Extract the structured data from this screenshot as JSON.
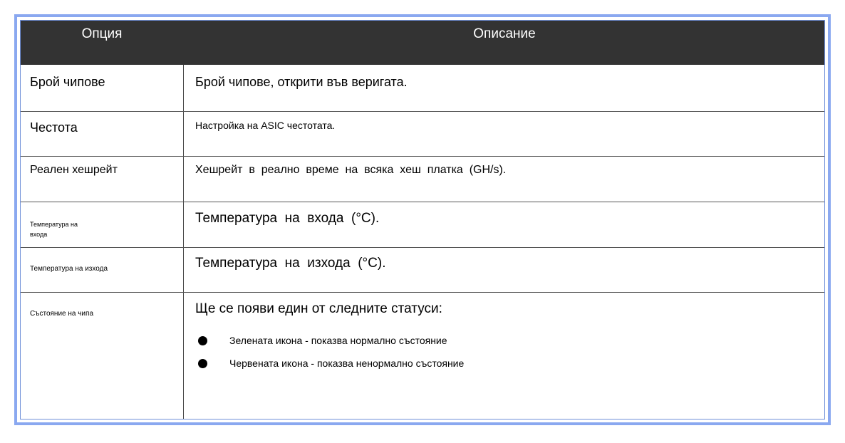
{
  "header": {
    "option": "Опция",
    "description": "Описание"
  },
  "rows": [
    {
      "option": "Брой чипове",
      "description": "Брой чипове, открити във веригата."
    },
    {
      "option": "Честота",
      "description": "Настройка на ASIC честотата."
    },
    {
      "option": "Реален хешрейт",
      "description": "Хешрейт  в  реално  време  на  всяка  хеш  платка  (GH/s)."
    },
    {
      "option_line1": "Температура на",
      "option_line2": "входа",
      "description": "Температура  на  входа  (°C)."
    },
    {
      "option": "Температура на изхода",
      "description": "Температура  на  изхода  (°C)."
    },
    {
      "option": "Състояние на чипа",
      "description": "Ще се появи един от следните статуси:",
      "bullets": [
        "Зелената икона - показва нормално състояние",
        "Червената икона - показва ненормално състояние"
      ]
    }
  ]
}
